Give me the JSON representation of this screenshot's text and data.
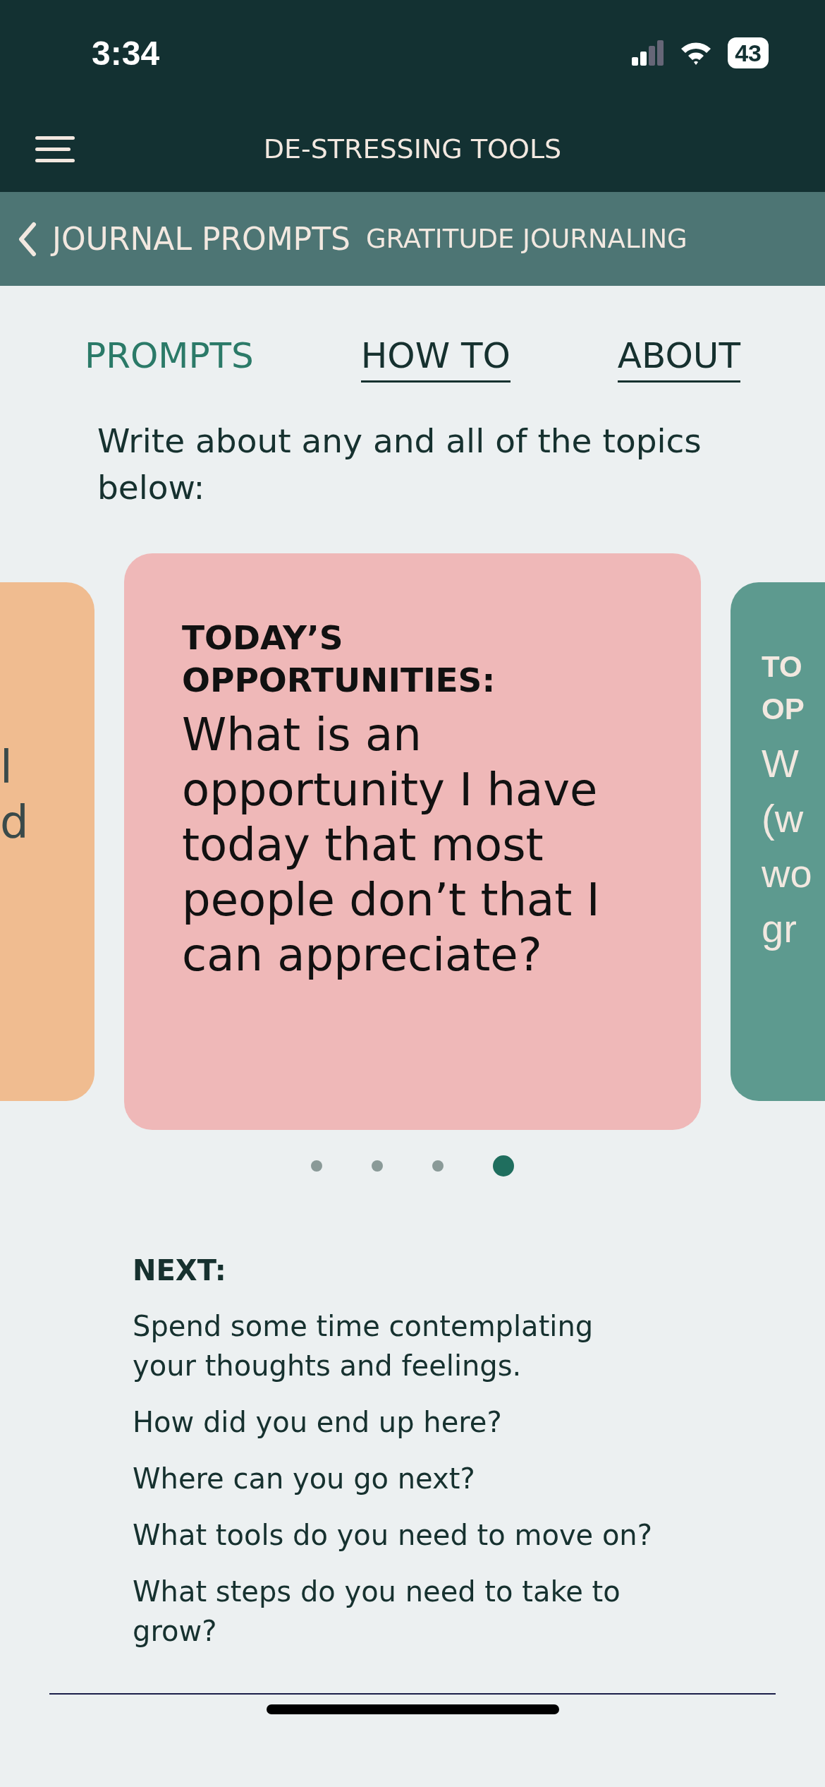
{
  "status_bar": {
    "time": "3:34",
    "battery": "43"
  },
  "header": {
    "title": "DE-STRESSING TOOLS"
  },
  "breadcrumb": {
    "back": "JOURNAL PROMPTS",
    "current": "GRATITUDE JOURNALING"
  },
  "tabs": [
    {
      "label": "PROMPTS",
      "selected": true
    },
    {
      "label": "HOW TO",
      "selected": false
    },
    {
      "label": "ABOUT",
      "selected": false
    }
  ],
  "intro": "Write about any and all of the topics below:",
  "cards": [
    {
      "kind": "peek-left",
      "color": "#f0bc90",
      "body_lines": [
        "l",
        "d"
      ]
    },
    {
      "kind": "full",
      "color": "#efb8b8",
      "heading": "TODAY’S OPPORTUNITIES:",
      "body": "What is an opportunity I have today that most people don’t that I can appreciate?"
    },
    {
      "kind": "peek-right",
      "color": "#5d9a8f",
      "heading_lines": [
        "TO",
        "OP"
      ],
      "body_lines": [
        "W",
        "(w",
        "wo",
        "gr"
      ]
    }
  ],
  "dots": [
    {
      "selected": false
    },
    {
      "selected": false
    },
    {
      "selected": false
    },
    {
      "selected": true
    }
  ],
  "next": {
    "heading": "NEXT:",
    "items": [
      "Spend some time contemplating your thoughts and feelings.",
      "How did you end up here?",
      "Where can you go next?",
      "What tools do you need to move on?",
      "What steps do you need to take to grow?"
    ]
  }
}
